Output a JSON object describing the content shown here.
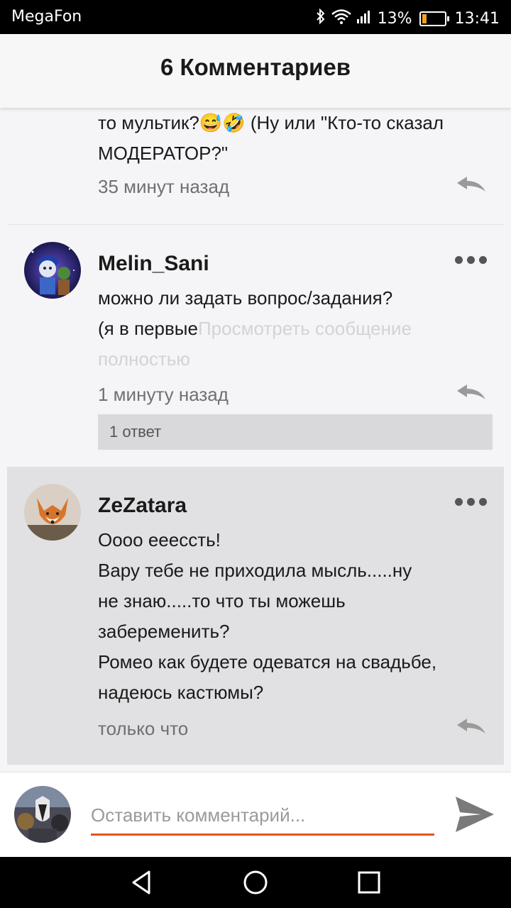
{
  "status_bar": {
    "carrier": "MegaFon",
    "battery": "13%",
    "battery_level": 0.13,
    "time": "13:41",
    "icons": [
      "bluetooth-icon",
      "wifi-icon",
      "signal-icon",
      "battery-icon"
    ]
  },
  "header": {
    "title": "6 Комментариев"
  },
  "comments": [
    {
      "text_lines": [
        "то мультик?😅🤣 (Ну или \"Кто-то сказал",
        "МОДЕРАТОР?\""
      ],
      "time": "35 минут назад"
    },
    {
      "username": "Melin_Sani",
      "text_lines": [
        "можно ли задать вопрос/задания?",
        "(я в первые"
      ],
      "view_full": "Просмотреть сообщение",
      "view_full_2": "полностью",
      "time": "1 минуту назад",
      "replies": "1 ответ"
    },
    {
      "username": "ZeZatara",
      "text_lines": [
        "Оооо ееессть!",
        "Вару тебе не приходила мысль.....ну",
        "не знаю.....то что ты можешь",
        "забеременить?",
        "Ромео как будете одеватся на свадьбе,",
        "надеюсь кастюмы?"
      ],
      "time": "только что"
    }
  ],
  "composer": {
    "placeholder": "Оставить комментарий..."
  },
  "colors": {
    "accent": "#e5541a",
    "selected_bg": "#e1e0e2",
    "background": "#f5f4f6"
  }
}
